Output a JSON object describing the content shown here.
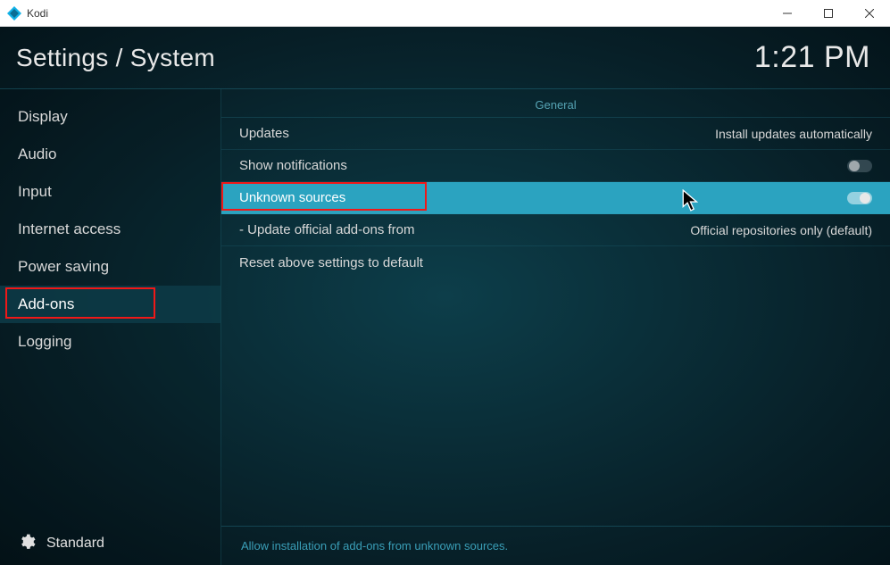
{
  "window": {
    "app_name": "Kodi"
  },
  "header": {
    "breadcrumb": "Settings / System",
    "clock": "1:21 PM"
  },
  "sidebar": {
    "items": [
      {
        "label": "Display"
      },
      {
        "label": "Audio"
      },
      {
        "label": "Input"
      },
      {
        "label": "Internet access"
      },
      {
        "label": "Power saving"
      },
      {
        "label": "Add-ons",
        "selected": true,
        "highlighted": true
      },
      {
        "label": "Logging"
      }
    ],
    "level_label": "Standard"
  },
  "main": {
    "section": "General",
    "rows": [
      {
        "label": "Updates",
        "value": "Install updates automatically"
      },
      {
        "label": "Show notifications",
        "toggle": false
      },
      {
        "label": "Unknown sources",
        "toggle": true,
        "highlighted": true,
        "red_box": true
      },
      {
        "label": "- Update official add-ons from",
        "value": "Official repositories only (default)"
      },
      {
        "label": "Reset above settings to default"
      }
    ],
    "helptext": "Allow installation of add-ons from unknown sources."
  }
}
